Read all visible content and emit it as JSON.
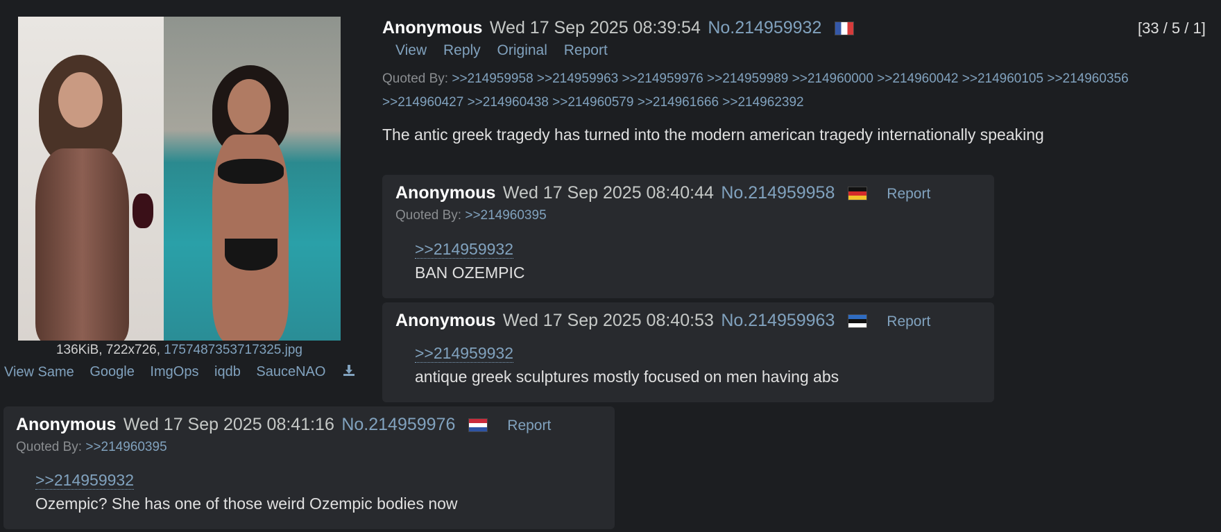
{
  "op": {
    "name": "Anonymous",
    "date": "Wed 17 Sep 2025 08:39:54",
    "number": "No.214959932",
    "flag": "flag-fr",
    "stats": "[33 / 5 / 1]",
    "actions": [
      "View",
      "Reply",
      "Original",
      "Report"
    ],
    "quoted_by_label": "Quoted By:",
    "quoted_by_line1": ">>214959958 >>214959963 >>214959976 >>214959989 >>214960000 >>214960042 >>214960105 >>214960356",
    "quoted_by_line2": ">>214960427 >>214960438 >>214960579 >>214961666 >>214962392",
    "comment": "The antic greek tragedy has turned into the modern american tragedy internationally speaking",
    "file": {
      "info": "136KiB, 722x726, ",
      "filename": "1757487353717325.jpg"
    },
    "image_tools": [
      "View Same",
      "Google",
      "ImgOps",
      "iqdb",
      "SauceNAO"
    ],
    "download_icon": "download-icon"
  },
  "replies": [
    {
      "name": "Anonymous",
      "date": "Wed 17 Sep 2025 08:40:44",
      "number": "No.214959958",
      "flag": "flag-de",
      "report": "Report",
      "quoted_by_label": "Quoted By:",
      "quoted_by": ">>214960395",
      "quote": ">>214959932",
      "text": "BAN OZEMPIC"
    },
    {
      "name": "Anonymous",
      "date": "Wed 17 Sep 2025 08:40:53",
      "number": "No.214959963",
      "flag": "flag-ee",
      "report": "Report",
      "quote": ">>214959932",
      "text": "antique greek sculptures mostly focused on men having abs"
    },
    {
      "name": "Anonymous",
      "date": "Wed 17 Sep 2025 08:41:16",
      "number": "No.214959976",
      "flag": "flag-nl",
      "report": "Report",
      "quoted_by_label": "Quoted By:",
      "quoted_by": ">>214960395",
      "quote": ">>214959932",
      "text": "Ozempic? She has one of those weird Ozempic bodies now"
    }
  ]
}
